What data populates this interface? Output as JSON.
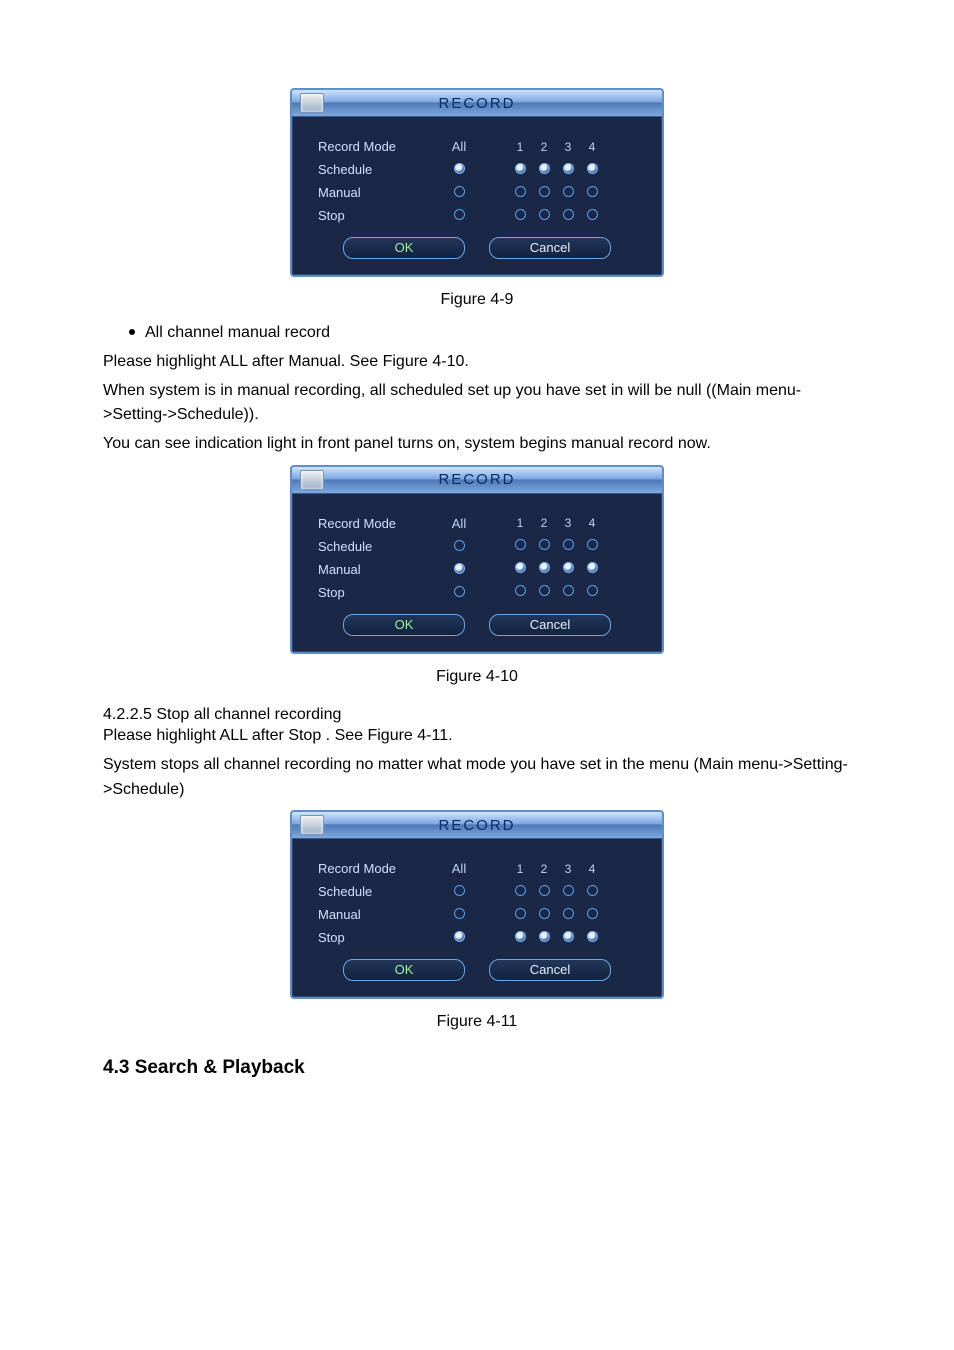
{
  "panels": {
    "common": {
      "title": "RECORD",
      "header_mode": "Record Mode",
      "header_all": "All",
      "chs": [
        "1",
        "2",
        "3",
        "4"
      ],
      "row_schedule": "Schedule",
      "row_manual": "Manual",
      "row_stop": "Stop",
      "ok": "OK",
      "cancel": "Cancel"
    },
    "fig9": {
      "selected": "Schedule"
    },
    "fig10": {
      "selected": "Manual"
    },
    "fig11": {
      "selected": "Stop"
    }
  },
  "captions": {
    "fig9": "Figure 4-9",
    "fig10": "Figure 4-10",
    "fig11": "Figure 4-11"
  },
  "text": {
    "bullet1": "All channel manual record",
    "p1a": "Please highlight  ALL  after  Manual.  See Figure 4-10.",
    "p1b": "When system is in manual recording, all scheduled set up you have set in will be null ((Main menu->Setting->Schedule)).",
    "p1c": "You can see indication light in front panel turns on, system begins manual record now.",
    "sect": "4.2.2.5  Stop all channel recording",
    "p2a": "Please highlight  ALL  after  Stop . See Figure 4-11.",
    "p2b": "System stops all channel recording no matter what mode you have set in the menu (Main menu->Setting->Schedule)",
    "bighead": "4.3  Search & Playback"
  }
}
